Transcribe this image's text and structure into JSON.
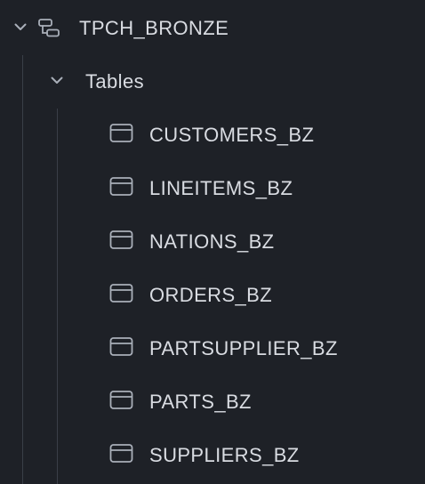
{
  "tree": {
    "schema": {
      "label": "TPCH_BRONZE",
      "icon": "schema-icon",
      "expanded": true
    },
    "folder": {
      "label": "Tables",
      "icon": "chevron-down-icon",
      "expanded": true
    },
    "tables": [
      {
        "label": "CUSTOMERS_BZ",
        "icon": "table-icon"
      },
      {
        "label": "LINEITEMS_BZ",
        "icon": "table-icon"
      },
      {
        "label": "NATIONS_BZ",
        "icon": "table-icon"
      },
      {
        "label": "ORDERS_BZ",
        "icon": "table-icon"
      },
      {
        "label": "PARTSUPPLIER_BZ",
        "icon": "table-icon"
      },
      {
        "label": "PARTS_BZ",
        "icon": "table-icon"
      },
      {
        "label": "SUPPLIERS_BZ",
        "icon": "table-icon"
      }
    ]
  },
  "colors": {
    "background": "#1e2127",
    "text": "#d9dce2",
    "icon": "#a9afb9",
    "guide": "#3a3f48"
  }
}
